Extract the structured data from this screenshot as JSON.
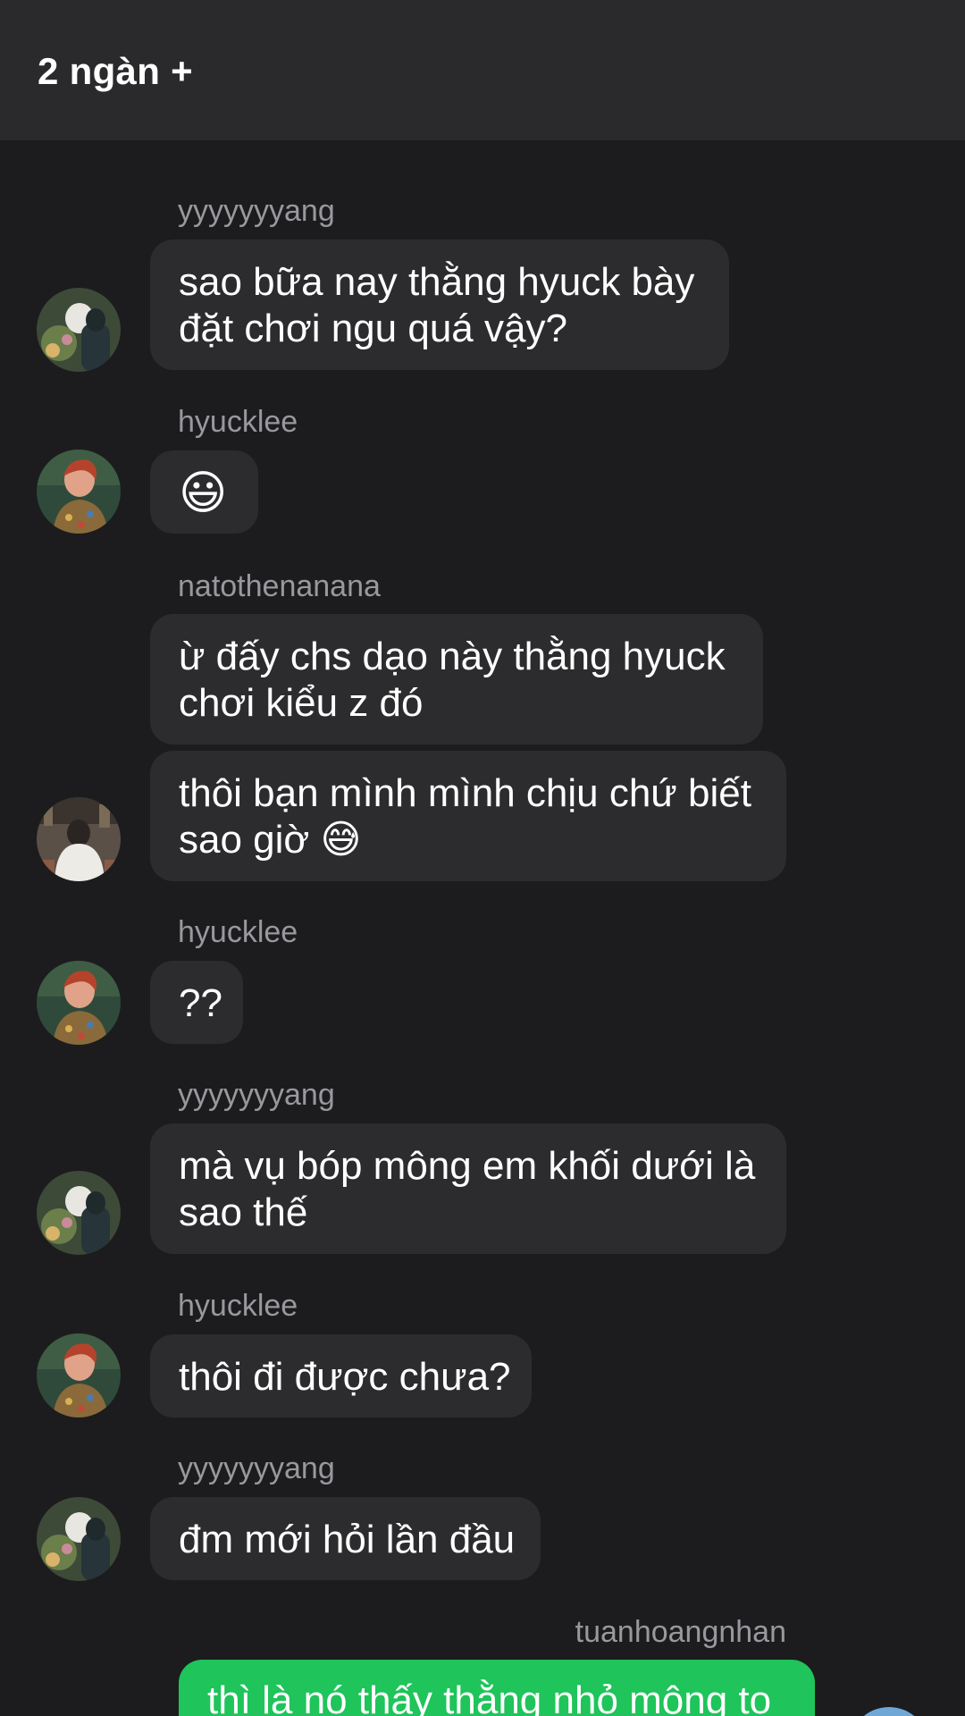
{
  "header": {
    "title": "2 ngàn +"
  },
  "messages": [
    {
      "user": "yyyyyyyang",
      "lines": [
        "sao bữa nay thằng hyuck bày",
        "đặt chơi ngu quá vậy?"
      ]
    },
    {
      "user": "hyucklee",
      "lines": [
        "😃"
      ]
    },
    {
      "user": "natothenanana",
      "lines": [
        "ừ đấy chs dạo này thằng hyuck",
        "chơi kiểu z đó"
      ]
    },
    {
      "user": "",
      "lines": [
        "thôi bạn mình mình chịu chứ biết",
        "sao giờ 😅"
      ]
    },
    {
      "user": "hyucklee",
      "lines": [
        "??"
      ]
    },
    {
      "user": "yyyyyyyang",
      "lines": [
        "mà vụ bóp mông em khối dưới là",
        "sao thế"
      ]
    },
    {
      "user": "hyucklee",
      "lines": [
        "thôi đi được chưa?"
      ]
    },
    {
      "user": "yyyyyyyang",
      "lines": [
        "đm mới hỏi lần đầu"
      ]
    },
    {
      "user": "tuanhoangnhan",
      "lines": [
        "thì là nó thấy thằng nhỏ mông to"
      ]
    }
  ],
  "icons": {
    "avatar_yang": "avatar-yyyyyyyang",
    "avatar_hyuck": "avatar-hyucklee",
    "avatar_nato": "avatar-natothenanana"
  },
  "colors": {
    "background": "#1c1c1e",
    "header": "#2a2a2c",
    "bubble_incoming": "#2c2c2e",
    "bubble_outgoing": "#1fc45a",
    "username": "#98989d"
  }
}
